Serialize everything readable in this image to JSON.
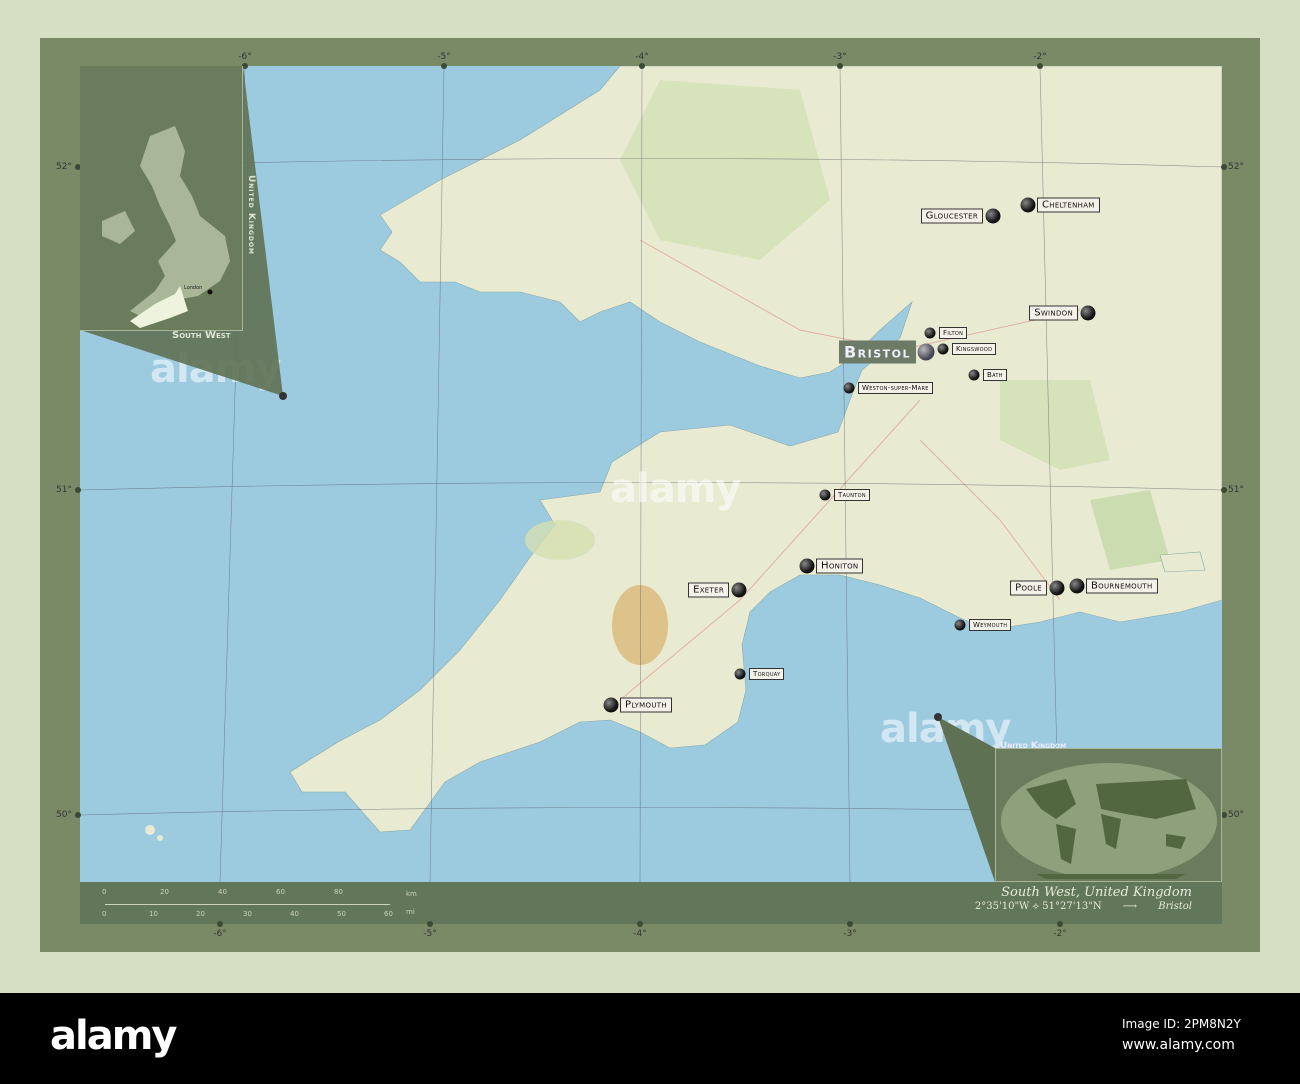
{
  "map_title": "South West, United Kingdom",
  "coordinates": "2°35'10\"W ⟡ 51°27'13\"N",
  "arrow": "⟶",
  "capital": "Bristol",
  "colors": {
    "sea": "#9ccbe0",
    "land": "#e9ead2",
    "frame": "#7b8a66",
    "inset": "#6b7c5d",
    "region": "#eef3de"
  },
  "longitudes_top": [
    "-6°",
    "-5°",
    "-4°",
    "-3°",
    "-2°"
  ],
  "longitudes_bottom": [
    "-6°",
    "-5°",
    "-4°",
    "-3°",
    "-2°"
  ],
  "latitudes": [
    "52°",
    "51°",
    "50°"
  ],
  "cities": [
    {
      "name": "Gloucester",
      "side": "left",
      "size": "big"
    },
    {
      "name": "Cheltenham",
      "side": "right",
      "size": "big"
    },
    {
      "name": "Swindon",
      "side": "left",
      "size": "big"
    },
    {
      "name": "Filton",
      "side": "right",
      "size": "small"
    },
    {
      "name": "Bristol",
      "side": "left",
      "size": "cap"
    },
    {
      "name": "Kingswood",
      "side": "right",
      "size": "small"
    },
    {
      "name": "Bath",
      "side": "right",
      "size": "small"
    },
    {
      "name": "Weston-super-Mare",
      "side": "right",
      "size": "small"
    },
    {
      "name": "Taunton",
      "side": "right",
      "size": "small"
    },
    {
      "name": "Honiton",
      "side": "right",
      "size": "big"
    },
    {
      "name": "Exeter",
      "side": "left",
      "size": "big"
    },
    {
      "name": "Poole",
      "side": "left",
      "size": "big"
    },
    {
      "name": "Bournemouth",
      "side": "right",
      "size": "big"
    },
    {
      "name": "Weymouth",
      "side": "right",
      "size": "small"
    },
    {
      "name": "Torquay",
      "side": "right",
      "size": "small"
    },
    {
      "name": "Plymouth",
      "side": "right",
      "size": "cap2"
    }
  ],
  "scale": {
    "km_ticks": [
      "0",
      "20",
      "40",
      "60",
      "80"
    ],
    "km_unit": "km",
    "mi_ticks": [
      "0",
      "10",
      "20",
      "30",
      "40",
      "50",
      "60"
    ],
    "mi_unit": "mi"
  },
  "inset_uk": {
    "country": "United Kingdom",
    "region": "South West",
    "city": "London"
  },
  "inset_world": {
    "label": "United Kingdom"
  },
  "watermark": "alamy",
  "footer": {
    "logo": "alamy",
    "image_id": "Image ID: 2PM8N2Y",
    "url": "www.alamy.com"
  }
}
